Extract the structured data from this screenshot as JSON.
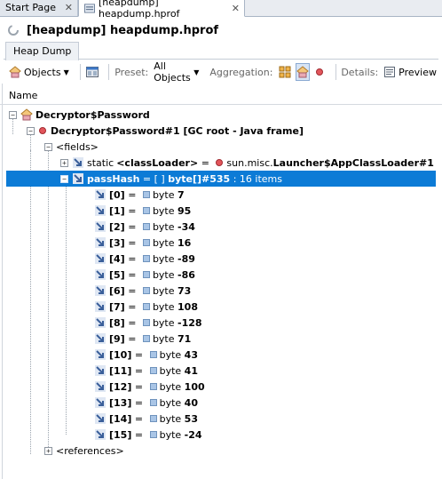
{
  "tabs": [
    {
      "label": "Start Page",
      "close": "✕"
    },
    {
      "label": "[heapdump] heapdump.hprof",
      "close": "✕"
    }
  ],
  "title": "[heapdump] heapdump.hprof",
  "subtab": "Heap Dump",
  "toolbar": {
    "objects_label": "Objects",
    "preset_label": "Preset:",
    "preset_value": "All Objects",
    "aggregation_label": "Aggregation:",
    "details_label": "Details:",
    "preview_label": "Preview"
  },
  "column_header": "Name",
  "tree": {
    "root": "Decryptor$Password",
    "instance": "Decryptor$Password#1 [GC root - Java frame]",
    "fields": "<fields>",
    "classloader": {
      "prefix": "static ",
      "name": "<classLoader>",
      "eq": " = ",
      "pkg": "sun.misc.",
      "cls": "Launcher$AppClassLoader#1"
    },
    "passhash": {
      "name": "passHash",
      "mid": " = [ ] ",
      "type": "byte[]#535",
      "suffix": " : 16 items"
    },
    "items": [
      {
        "index": "[0]",
        "value": "7"
      },
      {
        "index": "[1]",
        "value": "95"
      },
      {
        "index": "[2]",
        "value": "-34"
      },
      {
        "index": "[3]",
        "value": "16"
      },
      {
        "index": "[4]",
        "value": "-89"
      },
      {
        "index": "[5]",
        "value": "-86"
      },
      {
        "index": "[6]",
        "value": "73"
      },
      {
        "index": "[7]",
        "value": "108"
      },
      {
        "index": "[8]",
        "value": "-128"
      },
      {
        "index": "[9]",
        "value": "71"
      },
      {
        "index": "[10]",
        "value": "43"
      },
      {
        "index": "[11]",
        "value": "41"
      },
      {
        "index": "[12]",
        "value": "100"
      },
      {
        "index": "[13]",
        "value": "40"
      },
      {
        "index": "[14]",
        "value": "53"
      },
      {
        "index": "[15]",
        "value": "-24"
      }
    ],
    "eq": " = ",
    "byte": "byte ",
    "references": "<references>"
  }
}
